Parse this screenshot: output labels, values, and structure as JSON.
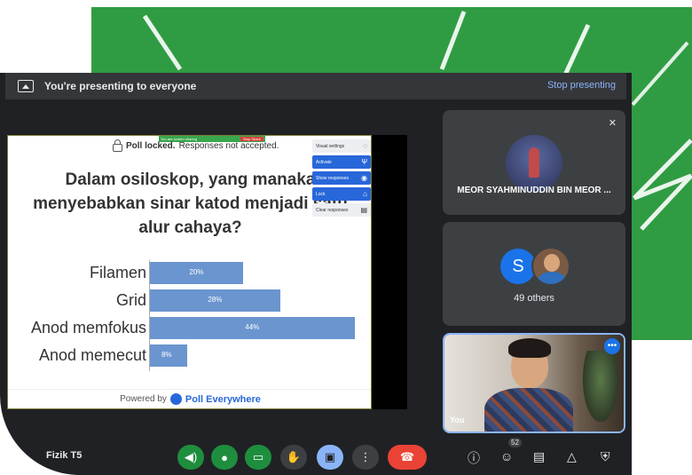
{
  "presentation_bar": {
    "message": "You're presenting to everyone",
    "stop_label": "Stop presenting"
  },
  "slide": {
    "share_strip": {
      "notice": "You are screen sharing",
      "stop": "Stop Share"
    },
    "locked_status": "Poll locked.",
    "locked_detail": "Responses not accepted.",
    "question_lines": [
      "Dalam osiloskop, yang manaka",
      "menyebabkan sinar katod menjadi satu",
      "alur cahaya?"
    ],
    "controls": {
      "visual_settings": "Visual settings",
      "activate": "Activate",
      "show_responses": "Show responses",
      "lock": "Lock",
      "clear_responses": "Clear responses"
    },
    "powered_by": "Powered by",
    "brand": "Poll Everywhere"
  },
  "chart_data": {
    "type": "bar",
    "orientation": "horizontal",
    "categories": [
      "Filamen",
      "Grid",
      "Anod memfokus",
      "Anod memecut"
    ],
    "values": [
      20,
      28,
      44,
      8
    ],
    "value_labels": [
      "20%",
      "28%",
      "44%",
      "8%"
    ],
    "xlim": [
      0,
      50
    ],
    "bar_color": "#6b95cf"
  },
  "tiles": {
    "participant1_name": "MEOR SYAHMINUDDIN BIN MEOR ...",
    "participant_initial": "S",
    "others_label": "49 others",
    "self_label": "You"
  },
  "bottom_bar": {
    "meeting_name": "Fizik T5",
    "participants_count": "52"
  },
  "colors": {
    "backdrop_green": "#2f9c43",
    "meet_bg": "#202124",
    "link_blue": "#8ab4f8",
    "bar_blue": "#6b95cf",
    "end_call_red": "#ea4335",
    "active_green": "#1e8e3e"
  },
  "icons": [
    "present-icon",
    "lock-icon",
    "mic-off-icon",
    "speaker-icon",
    "mic-icon",
    "camera-icon",
    "hand-icon",
    "present-now-icon",
    "more-icon",
    "end-call-icon",
    "info-icon",
    "people-icon",
    "chat-icon",
    "activities-icon",
    "host-controls-icon"
  ]
}
